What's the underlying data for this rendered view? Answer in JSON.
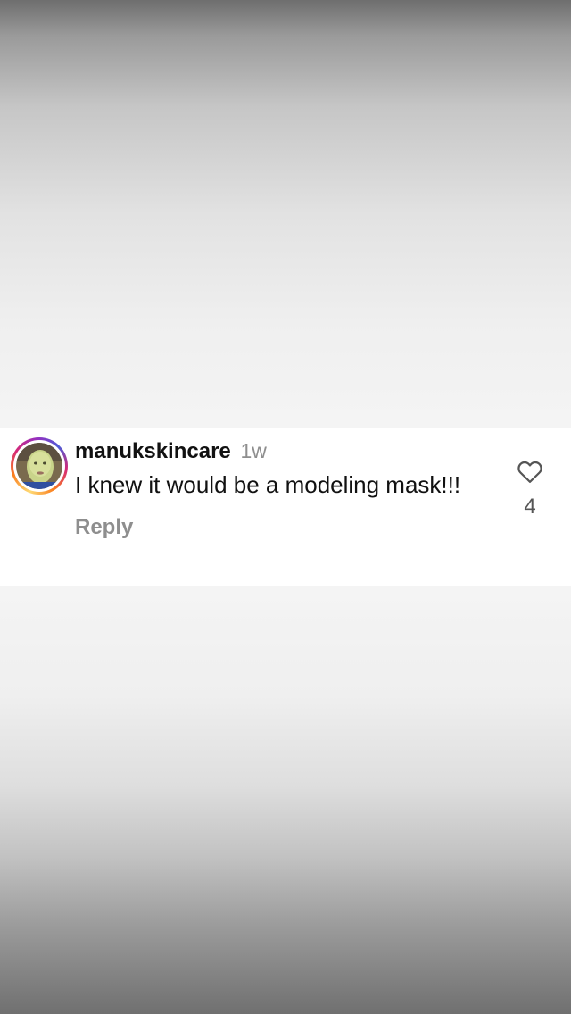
{
  "comment": {
    "username": "manukskincare",
    "timestamp": "1w",
    "text": "I knew it would be a modeling mask!!!",
    "reply_label": "Reply",
    "like_count": "4",
    "like_icon": "heart-outline-icon",
    "avatar_ring_colors": [
      "#feda75",
      "#fa7e1e",
      "#d62976",
      "#962fbf",
      "#4f5bd5"
    ]
  }
}
